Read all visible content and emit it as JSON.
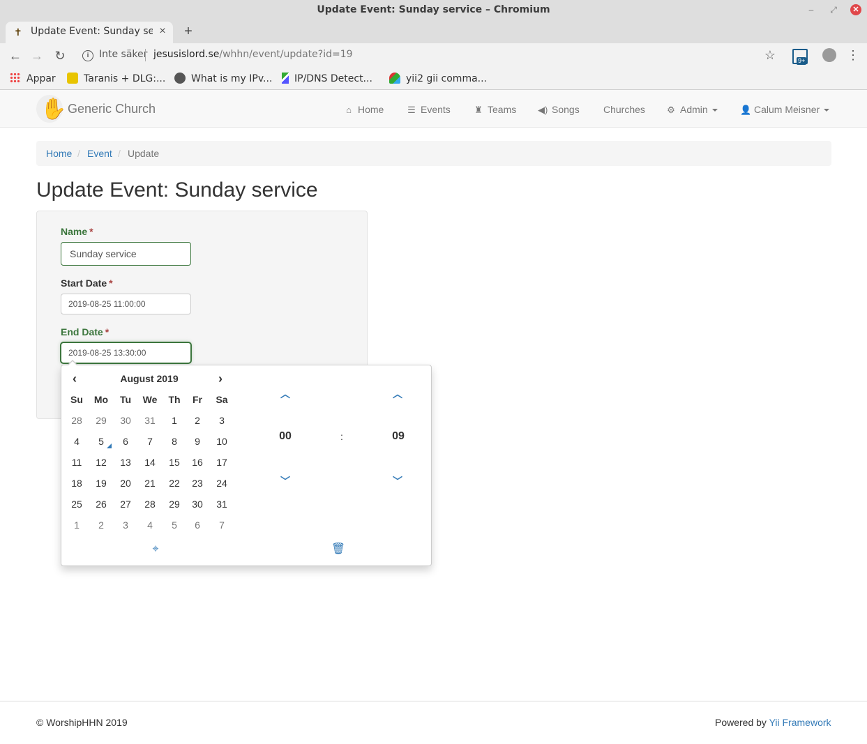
{
  "browser": {
    "window_title": "Update Event: Sunday service – Chromium",
    "tab_title": "Update Event: Sunday service",
    "security_label": "Inte säker",
    "url_host": "jesusislord.se",
    "url_path": "/whhn/event/update?id=19",
    "extension_badge": "9+",
    "bookmarks": [
      {
        "label": "Appar",
        "icon": "apps-grid-icon"
      },
      {
        "label": "Taranis + DLG:...",
        "icon": "radio-icon"
      },
      {
        "label": "What is my IPv...",
        "icon": "globe-icon"
      },
      {
        "label": "IP/DNS Detect...",
        "icon": "network-icon"
      },
      {
        "label": "yii2 gii comma...",
        "icon": "yii-icon"
      }
    ]
  },
  "navbar": {
    "brand": "Generic Church",
    "items": [
      {
        "label": "Home",
        "icon": "home-icon"
      },
      {
        "label": "Events",
        "icon": "list-icon"
      },
      {
        "label": "Teams",
        "icon": "tower-icon"
      },
      {
        "label": "Songs",
        "icon": "volume-icon"
      },
      {
        "label": "Churches",
        "icon": ""
      },
      {
        "label": "Admin",
        "icon": "cog-icon"
      },
      {
        "label": "Calum Meisner",
        "icon": "user-icon"
      }
    ]
  },
  "breadcrumb": {
    "home": "Home",
    "event": "Event",
    "current": "Update"
  },
  "page": {
    "title": "Update Event: Sunday service"
  },
  "form": {
    "name_label": "Name",
    "name_value": "Sunday service",
    "start_label": "Start Date",
    "start_value": "2019-08-25 11:00:00",
    "end_label": "End Date",
    "end_value": "2019-08-25 13:30:00",
    "required_mark": "*"
  },
  "datepicker": {
    "month_label": "August 2019",
    "weekdays": [
      "Su",
      "Mo",
      "Tu",
      "We",
      "Th",
      "Fr",
      "Sa"
    ],
    "weeks": [
      [
        {
          "d": "28",
          "old": true
        },
        {
          "d": "29",
          "old": true
        },
        {
          "d": "30",
          "old": true
        },
        {
          "d": "31",
          "old": true
        },
        {
          "d": "1"
        },
        {
          "d": "2"
        },
        {
          "d": "3"
        }
      ],
      [
        {
          "d": "4"
        },
        {
          "d": "5",
          "today": true
        },
        {
          "d": "6"
        },
        {
          "d": "7"
        },
        {
          "d": "8"
        },
        {
          "d": "9"
        },
        {
          "d": "10"
        }
      ],
      [
        {
          "d": "11"
        },
        {
          "d": "12"
        },
        {
          "d": "13"
        },
        {
          "d": "14"
        },
        {
          "d": "15"
        },
        {
          "d": "16"
        },
        {
          "d": "17"
        }
      ],
      [
        {
          "d": "18"
        },
        {
          "d": "19"
        },
        {
          "d": "20"
        },
        {
          "d": "21"
        },
        {
          "d": "22"
        },
        {
          "d": "23"
        },
        {
          "d": "24"
        }
      ],
      [
        {
          "d": "25"
        },
        {
          "d": "26"
        },
        {
          "d": "27"
        },
        {
          "d": "28"
        },
        {
          "d": "29"
        },
        {
          "d": "30"
        },
        {
          "d": "31"
        }
      ],
      [
        {
          "d": "1",
          "old": true
        },
        {
          "d": "2",
          "old": true
        },
        {
          "d": "3",
          "old": true
        },
        {
          "d": "4",
          "old": true
        },
        {
          "d": "5",
          "old": true
        },
        {
          "d": "6",
          "old": true
        },
        {
          "d": "7",
          "old": true
        }
      ]
    ],
    "hours": "00",
    "minutes": "09",
    "separator": ":"
  },
  "footer": {
    "copyright": "© WorshipHHN 2019",
    "powered_prefix": "Powered by ",
    "powered_link": "Yii Framework"
  },
  "colors": {
    "link": "#337ab7",
    "success": "#3c763d",
    "required": "#a94442"
  }
}
